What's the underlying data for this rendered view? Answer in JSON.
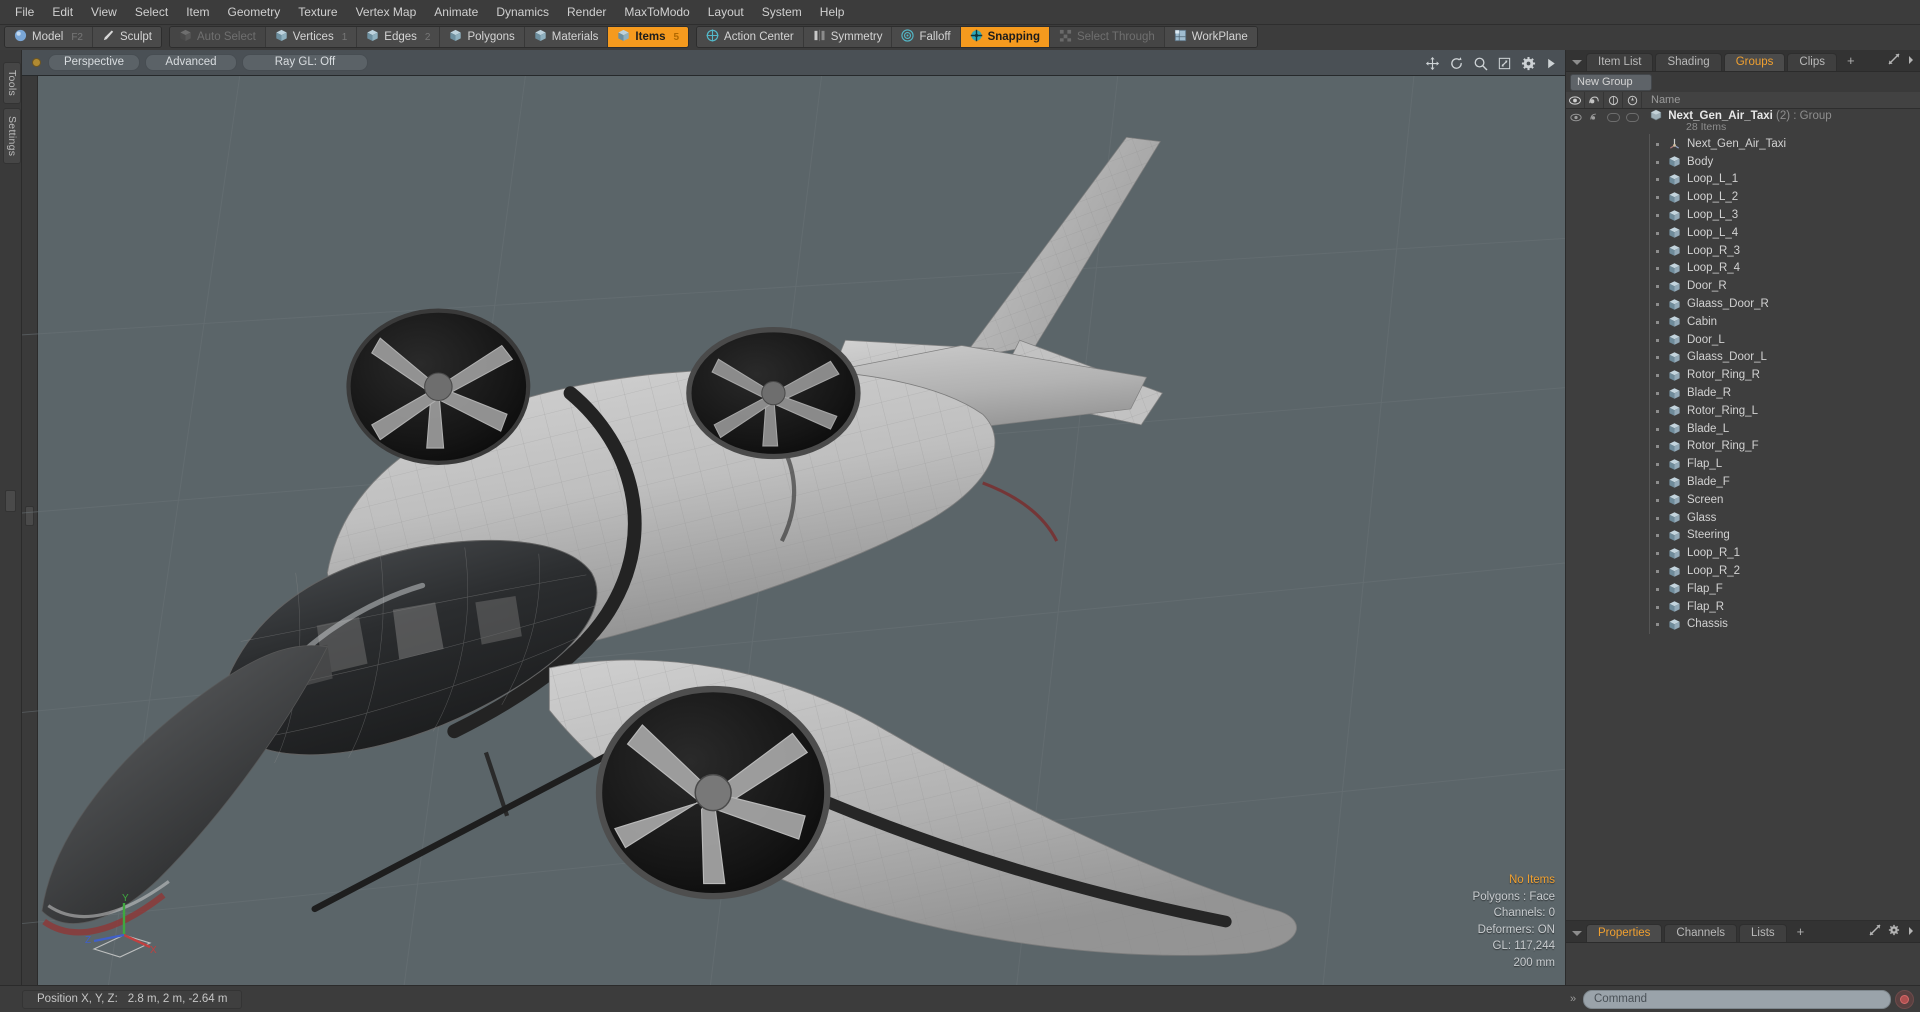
{
  "menubar": {
    "items": [
      "File",
      "Edit",
      "View",
      "Select",
      "Item",
      "Geometry",
      "Texture",
      "Vertex Map",
      "Animate",
      "Dynamics",
      "Render",
      "MaxToModo",
      "Layout",
      "System",
      "Help"
    ]
  },
  "toolbar": {
    "groups": [
      {
        "buttons": [
          {
            "label": "Model",
            "icon": "sphere-icon",
            "state": "normal",
            "num": "F2"
          },
          {
            "label": "Sculpt",
            "icon": "brush-icon",
            "state": "normal",
            "num": ""
          }
        ]
      },
      {
        "buttons": [
          {
            "label": "Auto Select",
            "icon": "cube-icon",
            "state": "dim",
            "num": ""
          },
          {
            "label": "Vertices",
            "icon": "cube-icon",
            "state": "normal",
            "num": "1"
          },
          {
            "label": "Edges",
            "icon": "cube-icon",
            "state": "normal",
            "num": "2"
          },
          {
            "label": "Polygons",
            "icon": "cube-icon",
            "state": "normal",
            "num": ""
          },
          {
            "label": "Materials",
            "icon": "cube-icon",
            "state": "normal",
            "num": ""
          },
          {
            "label": "Items",
            "icon": "cube-icon",
            "state": "on",
            "num": "5"
          }
        ]
      },
      {
        "buttons": [
          {
            "label": "Action Center",
            "icon": "target-icon",
            "state": "normal",
            "num": ""
          },
          {
            "label": "Symmetry",
            "icon": "symmetry-icon",
            "state": "normal",
            "num": ""
          },
          {
            "label": "Falloff",
            "icon": "falloff-icon",
            "state": "normal",
            "num": ""
          },
          {
            "label": "Snapping",
            "icon": "snap-icon",
            "state": "on",
            "num": ""
          },
          {
            "label": "Select Through",
            "icon": "through-icon",
            "state": "dim",
            "num": ""
          },
          {
            "label": "WorkPlane",
            "icon": "workplane-icon",
            "state": "normal",
            "num": ""
          }
        ]
      }
    ]
  },
  "left_strip": {
    "tabs": [
      "Tools",
      "Settings"
    ]
  },
  "viewport": {
    "header": {
      "view_mode": "Perspective",
      "shading": "Advanced",
      "raygl": "Ray GL: Off",
      "icons": [
        "move-icon",
        "rotate-icon",
        "zoom-icon",
        "fit-icon",
        "gear-icon",
        "play-icon"
      ]
    },
    "stats": {
      "selection": "No Items",
      "polygons": "Polygons : Face",
      "channels": "Channels: 0",
      "deformers": "Deformers: ON",
      "gl": "GL: 117,244",
      "grid": "200 mm"
    },
    "axis": {
      "x": "X",
      "y": "Y",
      "z": "Z"
    }
  },
  "right_panel": {
    "tabs": [
      {
        "label": "Item List",
        "selected": false
      },
      {
        "label": "Shading",
        "selected": false
      },
      {
        "label": "Groups",
        "selected": true
      },
      {
        "label": "Clips",
        "selected": false
      }
    ],
    "add_tab": "+",
    "new_group_button": "New Group",
    "list_header": {
      "name": "Name",
      "icons": [
        "eye-icon",
        "render-icon",
        "wireframe-icon",
        "select-icon"
      ]
    },
    "group": {
      "name": "Next_Gen_Air_Taxi",
      "count": "(2)",
      "type": ": Group",
      "subtitle": "28 Items"
    },
    "items": [
      {
        "label": "Next_Gen_Air_Taxi",
        "icon": "locator-icon"
      },
      {
        "label": "Body",
        "icon": "mesh-icon"
      },
      {
        "label": "Loop_L_1",
        "icon": "mesh-icon"
      },
      {
        "label": "Loop_L_2",
        "icon": "mesh-icon"
      },
      {
        "label": "Loop_L_3",
        "icon": "mesh-icon"
      },
      {
        "label": "Loop_L_4",
        "icon": "mesh-icon"
      },
      {
        "label": "Loop_R_3",
        "icon": "mesh-icon"
      },
      {
        "label": "Loop_R_4",
        "icon": "mesh-icon"
      },
      {
        "label": "Door_R",
        "icon": "mesh-icon"
      },
      {
        "label": "Glaass_Door_R",
        "icon": "mesh-icon"
      },
      {
        "label": "Cabin",
        "icon": "mesh-icon"
      },
      {
        "label": "Door_L",
        "icon": "mesh-icon"
      },
      {
        "label": "Glaass_Door_L",
        "icon": "mesh-icon"
      },
      {
        "label": "Rotor_Ring_R",
        "icon": "mesh-icon"
      },
      {
        "label": "Blade_R",
        "icon": "mesh-icon"
      },
      {
        "label": "Rotor_Ring_L",
        "icon": "mesh-icon"
      },
      {
        "label": "Blade_L",
        "icon": "mesh-icon"
      },
      {
        "label": "Rotor_Ring_F",
        "icon": "mesh-icon"
      },
      {
        "label": "Flap_L",
        "icon": "mesh-icon"
      },
      {
        "label": "Blade_F",
        "icon": "mesh-icon"
      },
      {
        "label": "Screen",
        "icon": "mesh-icon"
      },
      {
        "label": "Glass",
        "icon": "mesh-icon"
      },
      {
        "label": "Steering",
        "icon": "mesh-icon"
      },
      {
        "label": "Loop_R_1",
        "icon": "mesh-icon"
      },
      {
        "label": "Loop_R_2",
        "icon": "mesh-icon"
      },
      {
        "label": "Flap_F",
        "icon": "mesh-icon"
      },
      {
        "label": "Flap_R",
        "icon": "mesh-icon"
      },
      {
        "label": "Chassis",
        "icon": "mesh-icon"
      }
    ],
    "bottom_tabs": [
      {
        "label": "Properties",
        "selected": true
      },
      {
        "label": "Channels",
        "selected": false
      },
      {
        "label": "Lists",
        "selected": false
      }
    ],
    "bottom_add_tab": "+"
  },
  "statusbar": {
    "position_label": "Position X, Y, Z:",
    "position_value": "2.8 m, 2 m, -2.64 m",
    "command_placeholder": "Command"
  },
  "colors": {
    "accent": "#f59a1e",
    "panel": "#3a3a3a",
    "viewport_bg": "#5b6569",
    "text": "#c8c8c8"
  }
}
